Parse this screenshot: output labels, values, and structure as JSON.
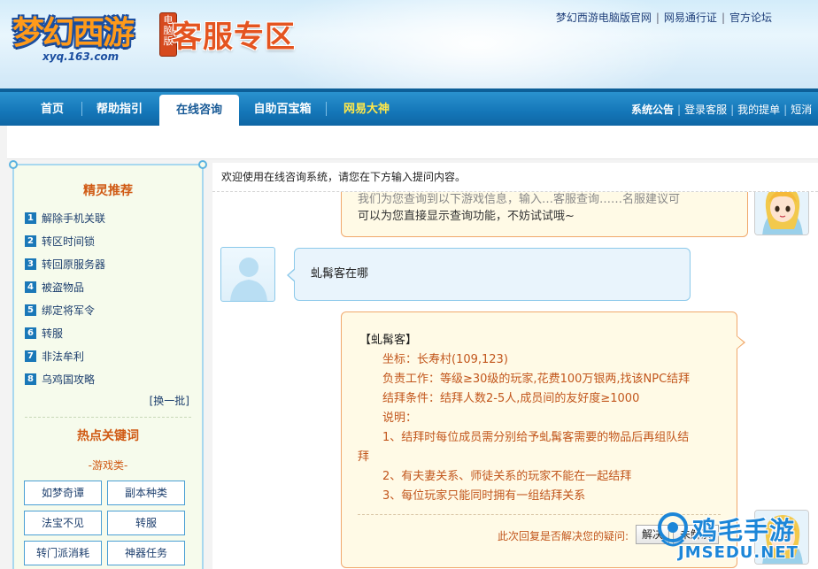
{
  "header": {
    "game_name": "梦幻西游",
    "edition_badge": "电脑版",
    "domain": "xyq.163.com",
    "zone_title": "客服专区",
    "top_links": [
      "梦幻西游电脑版官网",
      "网易通行证",
      "官方论坛"
    ]
  },
  "nav": {
    "items": [
      "首页",
      "帮助指引",
      "在线咨询",
      "自助百宝箱",
      "网易大神"
    ],
    "active": "在线咨询",
    "right_links": [
      "系统公告",
      "登录客服",
      "我的提单",
      "短消"
    ]
  },
  "sidebar": {
    "recommend_title": "精灵推荐",
    "recommend_items": [
      {
        "num": "1",
        "label": "解除手机关联"
      },
      {
        "num": "2",
        "label": "转区时间锁"
      },
      {
        "num": "3",
        "label": "转回原服务器"
      },
      {
        "num": "4",
        "label": "被盗物品"
      },
      {
        "num": "5",
        "label": "绑定将军令"
      },
      {
        "num": "6",
        "label": "转服"
      },
      {
        "num": "7",
        "label": "非法牟利"
      },
      {
        "num": "8",
        "label": "乌鸡国攻略"
      }
    ],
    "swap_label": "[换一批]",
    "hot_title": "热点关键词",
    "category": "-游戏类-",
    "keywords": [
      "如梦奇谭",
      "副本种类",
      "法宝不见",
      "转服",
      "转门派消耗",
      "神器任务"
    ]
  },
  "chat": {
    "welcome": "欢迎使用在线咨询系统，请您在下方输入提问内容。",
    "prev_bot_line_cut": "我们为您查询到以下游戏信息，输入…客服查询……名服建议可",
    "prev_bot_line": "可以为您直接显示查询功能，不妨试试哦~",
    "user_message": "虬髯客在哪",
    "answer": {
      "title": "【虬髯客】",
      "lines": [
        "坐标：长寿村(109,123)",
        "负责工作：等级≥30级的玩家,花费100万银两,找该NPC结拜",
        "结拜条件：结拜人数2-5人,成员间的友好度≥1000",
        "说明：",
        "1、结拜时每位成员需分别给予虬髯客需要的物品后再组队结",
        "拜",
        "2、有夫妻关系、师徒关系的玩家不能在一起结拜",
        "3、每位玩家只能同时拥有一组结拜关系"
      ],
      "feedback_question": "此次回复是否解决您的疑问:",
      "resolved_label": "解决",
      "unresolved_label": "未解决"
    }
  },
  "watermark": {
    "text": "鸡毛手游",
    "domain": "JMSEDU.NET"
  },
  "colors": {
    "nav_blue": "#1476b8",
    "accent_orange": "#d05a14",
    "answer_text": "#c2561c",
    "answer_bg": "#fffae6",
    "user_bubble_bg": "#e9f4fc"
  }
}
